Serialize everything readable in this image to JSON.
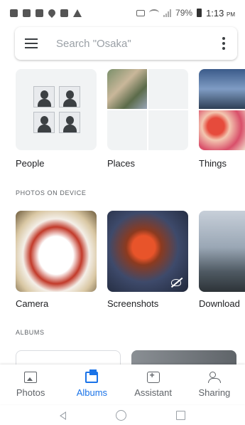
{
  "status_bar": {
    "battery_percent": "79%",
    "time": "1:13",
    "time_suffix": "PM"
  },
  "search": {
    "placeholder": "Search \"Osaka\""
  },
  "categories": [
    {
      "label": "People"
    },
    {
      "label": "Places"
    },
    {
      "label": "Things"
    }
  ],
  "sections": {
    "photos_on_device": "PHOTOS ON DEVICE",
    "albums": "ALBUMS"
  },
  "device_folders": [
    {
      "label": "Camera"
    },
    {
      "label": "Screenshots"
    },
    {
      "label": "Download"
    }
  ],
  "bottom_nav": [
    {
      "label": "Photos",
      "active": false
    },
    {
      "label": "Albums",
      "active": true
    },
    {
      "label": "Assistant",
      "active": false
    },
    {
      "label": "Sharing",
      "active": false
    }
  ],
  "colors": {
    "accent": "#1a73e8",
    "text": "#202124",
    "muted": "#5f6368"
  }
}
